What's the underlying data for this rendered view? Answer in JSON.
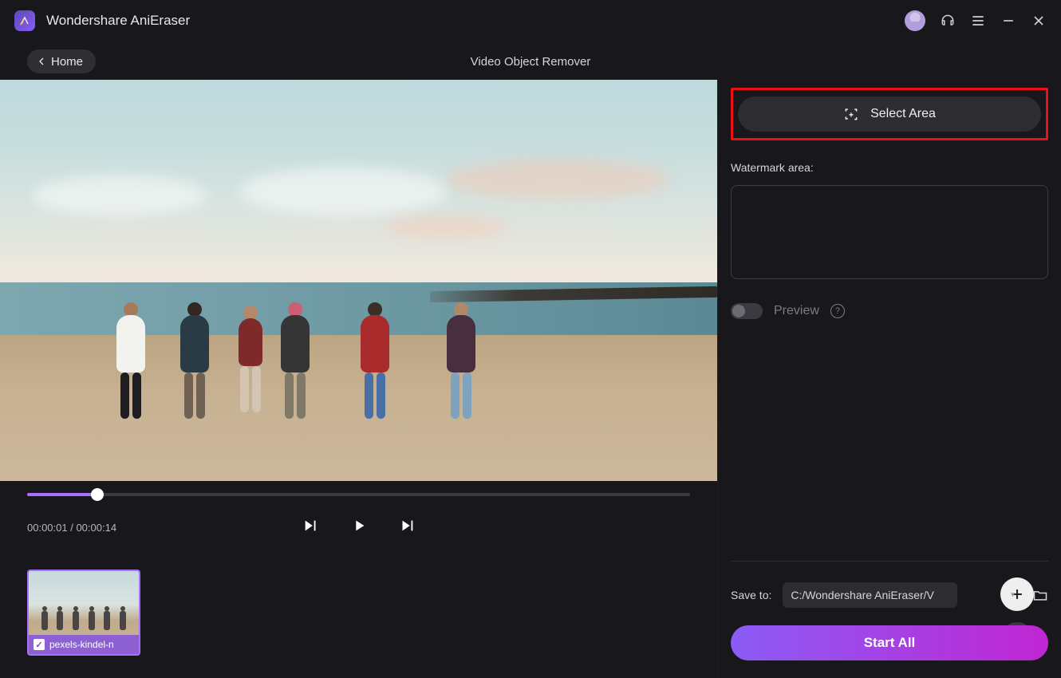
{
  "app": {
    "title": "Wondershare AniEraser"
  },
  "header": {
    "home_label": "Home",
    "page_title": "Video Object Remover"
  },
  "player": {
    "current_time": "00:00:01",
    "duration": "00:00:14",
    "progress_percent": 10.6
  },
  "thumbnail": {
    "filename": "pexels-kindel-n",
    "selected": true
  },
  "right_panel": {
    "select_area_label": "Select Area",
    "watermark_label": "Watermark area:",
    "preview_label": "Preview",
    "save_label": "Save to:",
    "save_path": "C:/Wondershare AniEraser/V",
    "start_label": "Start All"
  },
  "colors": {
    "accent": "#a970ff",
    "highlight": "#e11",
    "gradient_start": "#8b5cf6",
    "gradient_end": "#c026d3"
  }
}
